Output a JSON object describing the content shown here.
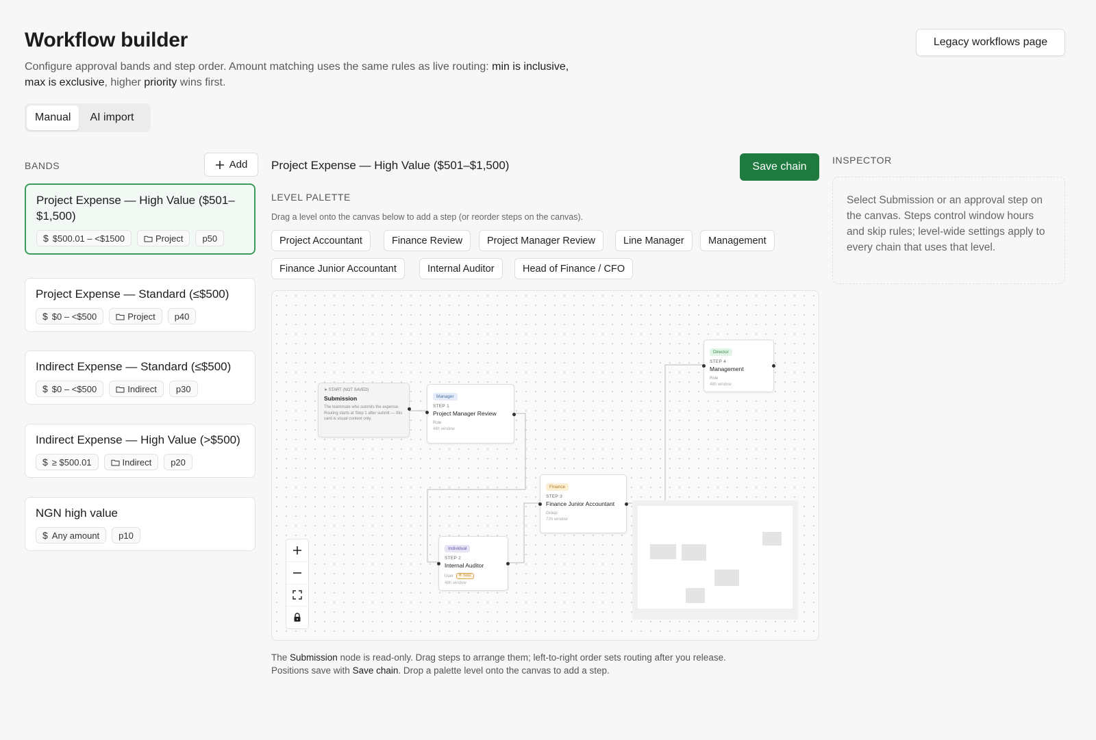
{
  "header": {
    "title": "Workflow builder",
    "subtitle": {
      "p1": "Configure approval bands and step order. Amount matching uses the same rules as live routing: ",
      "b1": "min is inclusive, max is exclusive",
      "p2": ", higher ",
      "b2": "priority",
      "p3": " wins first."
    },
    "legacy_button": "Legacy workflows page",
    "modes": [
      {
        "label": "Manual",
        "active": true
      },
      {
        "label": "AI import",
        "active": false
      }
    ]
  },
  "bands": {
    "label": "BANDS",
    "add_label": "Add",
    "items": [
      {
        "title": "Project Expense — High Value ($501–$1,500)",
        "amount": "$500.01 – <$1500",
        "scope": "Project",
        "priority": "p50",
        "selected": true
      },
      {
        "title": "Project Expense — Standard (≤$500)",
        "amount": "$0 – <$500",
        "scope": "Project",
        "priority": "p40",
        "selected": false
      },
      {
        "title": "Indirect Expense — Standard (≤$500)",
        "amount": "$0 – <$500",
        "scope": "Indirect",
        "priority": "p30",
        "selected": false
      },
      {
        "title": "Indirect Expense — High Value (>$500)",
        "amount": "≥ $500.01",
        "scope": "Indirect",
        "priority": "p20",
        "selected": false
      },
      {
        "title": "NGN high value",
        "amount": "Any amount",
        "scope": "",
        "priority": "p10",
        "selected": false
      }
    ]
  },
  "chain": {
    "title": "Project Expense — High Value ($501–$1,500)",
    "save_label": "Save chain"
  },
  "palette": {
    "label": "LEVEL PALETTE",
    "hint": "Drag a level onto the canvas below to add a step (or reorder steps on the canvas).",
    "levels": [
      "Project Accountant",
      "Finance Review",
      "Project Manager Review",
      "Line Manager",
      "Management",
      "Finance Junior Accountant",
      "Internal Auditor",
      "Head of Finance / CFO"
    ]
  },
  "canvas": {
    "submission": {
      "start": "START (NOT SAVED)",
      "name": "Submission",
      "desc": "The teammate who submits the expense. Routing starts at Step 1 after submit — this card is visual context only."
    },
    "steps": [
      {
        "badge": "Manager",
        "step": "STEP 1",
        "name": "Project Manager Review",
        "meta": "Role",
        "window": "48h window",
        "badge_bg": "#e3ecf8",
        "badge_fg": "#4a6fa5"
      },
      {
        "badge": "Individual",
        "step": "STEP 2",
        "name": "Internal Auditor",
        "meta": "User",
        "sod": "SoD",
        "window": "48h window",
        "badge_bg": "#e8e4f6",
        "badge_fg": "#6a5aa8"
      },
      {
        "badge": "Finance",
        "step": "STEP 3",
        "name": "Finance Junior Accountant",
        "meta": "Group",
        "window": "72h window",
        "badge_bg": "#fbeed2",
        "badge_fg": "#a87a1e"
      },
      {
        "badge": "Director",
        "step": "STEP 4",
        "name": "Management",
        "meta": "Role",
        "window": "48h window",
        "badge_bg": "#e2f4e6",
        "badge_fg": "#3c8a52"
      }
    ]
  },
  "footer": {
    "p1": "The ",
    "b1": "Submission",
    "p2": " node is read-only. Drag steps to arrange them; left-to-right order sets routing after you release.",
    "p3": "Positions save with ",
    "b2": "Save chain",
    "p4": ". Drop a palette level onto the canvas to add a step."
  },
  "inspector": {
    "label": "INSPECTOR",
    "text": "Select Submission or an approval step on the canvas. Steps control window hours and skip rules; level-wide settings apply to every chain that uses that level."
  },
  "colors": {
    "accent": "#1e7a3e",
    "selected_border": "#3c9a5c",
    "selected_bg": "#f2f8f4"
  }
}
